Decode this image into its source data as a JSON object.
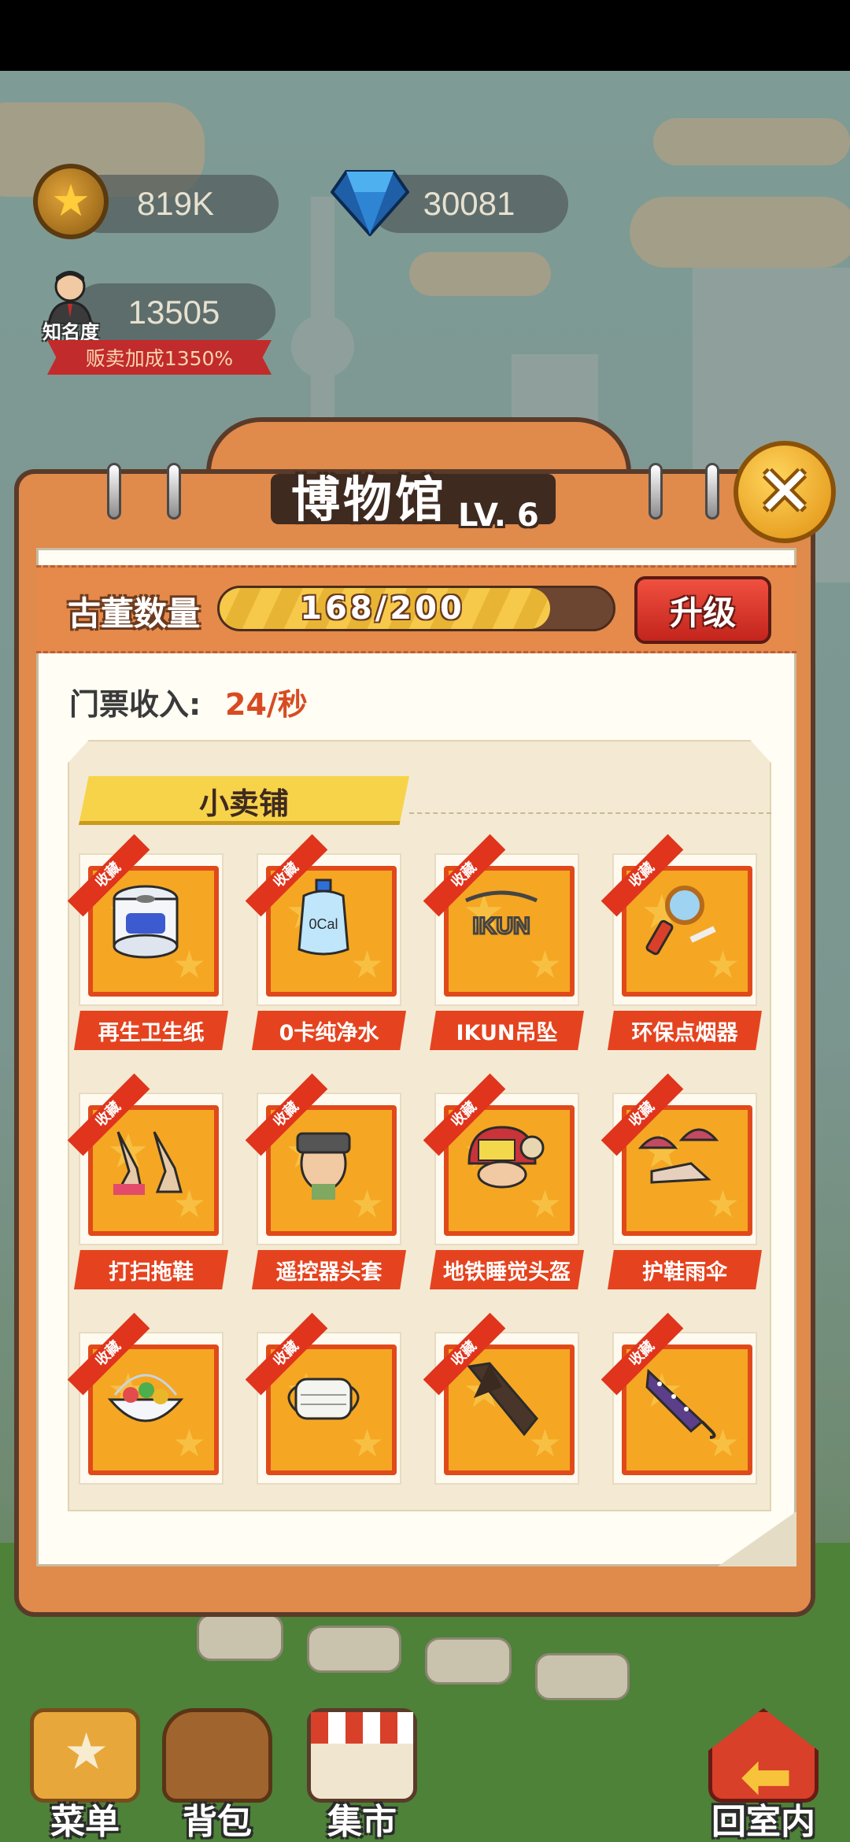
{
  "hud": {
    "coins": "819K",
    "diamonds": "30081",
    "fame_value": "13505",
    "fame_label": "知名度",
    "bonus_text": "贩卖加成1350%"
  },
  "panel": {
    "title": "博物馆",
    "level": "LV. 6",
    "antique_label": "古董数量",
    "antique_progress_text": "168/200",
    "antique_current": 168,
    "antique_max": 200,
    "upgrade_label": "升级",
    "ticket_label": "门票收入:",
    "ticket_value": "24/秒",
    "section_title": "小卖铺",
    "collected_tag": "收藏",
    "items": [
      {
        "name": "再生卫生纸",
        "icon": "toilet-paper-icon"
      },
      {
        "name": "0卡纯净水",
        "icon": "water-bottle-icon",
        "icon_text": "0Cal"
      },
      {
        "name": "IKUN吊坠",
        "icon": "ikun-pendant-icon",
        "icon_text": "IKUN"
      },
      {
        "name": "环保点烟器",
        "icon": "magnifier-lighter-icon"
      },
      {
        "name": "打扫拖鞋",
        "icon": "mop-slippers-icon"
      },
      {
        "name": "遥控器头套",
        "icon": "remote-headgear-icon"
      },
      {
        "name": "地铁睡觉头盔",
        "icon": "subway-sleep-helmet-icon"
      },
      {
        "name": "护鞋雨伞",
        "icon": "shoe-umbrella-icon"
      },
      {
        "name": "",
        "icon": "candy-bowl-icon"
      },
      {
        "name": "",
        "icon": "face-mask-icon"
      },
      {
        "name": "",
        "icon": "tie-icon"
      },
      {
        "name": "",
        "icon": "dotted-umbrella-icon"
      }
    ]
  },
  "nav": {
    "menu": "菜单",
    "backpack": "背包",
    "market": "集市",
    "go_indoor": "回室内"
  },
  "colors": {
    "panel_orange": "#e08a4c",
    "upgrade_red": "#e0341c",
    "ticket_value": "#d84b22",
    "progress_yellow": "#f6c94a"
  }
}
